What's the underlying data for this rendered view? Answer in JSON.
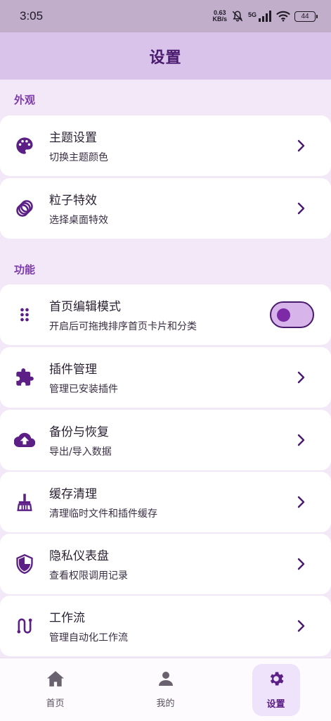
{
  "status_bar": {
    "time": "3:05",
    "net_speed_value": "0.63",
    "net_speed_unit": "KB/s",
    "network": "5G",
    "battery": "44"
  },
  "header": {
    "title": "设置"
  },
  "sections": [
    {
      "label": "外观"
    },
    {
      "label": "功能"
    }
  ],
  "items": [
    {
      "icon": "palette-icon",
      "title": "主题设置",
      "subtitle": "切换主题颜色",
      "control": "chevron"
    },
    {
      "icon": "rings-icon",
      "title": "粒子特效",
      "subtitle": "选择桌面特效",
      "control": "chevron"
    },
    {
      "icon": "drag-dots-icon",
      "title": "首页编辑模式",
      "subtitle": "开启后可拖拽排序首页卡片和分类",
      "control": "toggle",
      "toggle_on": false
    },
    {
      "icon": "puzzle-icon",
      "title": "插件管理",
      "subtitle": "管理已安装插件",
      "control": "chevron"
    },
    {
      "icon": "cloud-upload-icon",
      "title": "备份与恢复",
      "subtitle": "导出/导入数据",
      "control": "chevron"
    },
    {
      "icon": "broom-icon",
      "title": "缓存清理",
      "subtitle": "清理临时文件和插件缓存",
      "control": "chevron"
    },
    {
      "icon": "shield-icon",
      "title": "隐私仪表盘",
      "subtitle": "查看权限调用记录",
      "control": "chevron"
    },
    {
      "icon": "workflow-icon",
      "title": "工作流",
      "subtitle": "管理自动化工作流",
      "control": "chevron"
    }
  ],
  "bottom_nav": [
    {
      "icon": "home-icon",
      "label": "首页",
      "active": false
    },
    {
      "icon": "person-icon",
      "label": "我的",
      "active": false
    },
    {
      "icon": "gear-icon",
      "label": "设置",
      "active": true
    }
  ],
  "colors": {
    "accent": "#5b1f86",
    "header_bg": "#d9c3ea",
    "page_bg": "#f3e8f8",
    "section_label": "#7c3aab"
  }
}
